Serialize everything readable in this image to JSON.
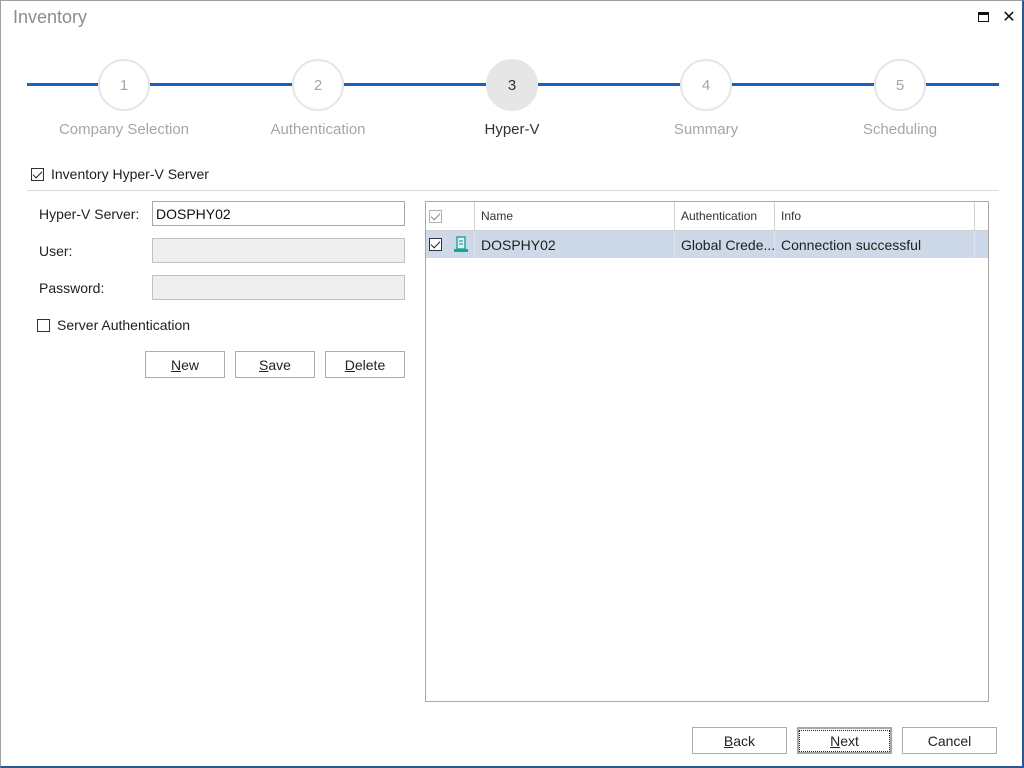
{
  "window": {
    "title": "Inventory",
    "maximize_icon": "maximize-icon",
    "close_icon": "close-icon",
    "close_glyph": "✕"
  },
  "stepper": {
    "accent_color": "#1565c0",
    "active_step": 3,
    "steps": [
      {
        "number": "1",
        "label": "Company Selection"
      },
      {
        "number": "2",
        "label": "Authentication"
      },
      {
        "number": "3",
        "label": "Hyper-V"
      },
      {
        "number": "4",
        "label": "Summary"
      },
      {
        "number": "5",
        "label": "Scheduling"
      }
    ]
  },
  "inventory_checkbox": {
    "label": "Inventory Hyper-V Server",
    "checked": true
  },
  "form": {
    "server_label": "Hyper-V Server:",
    "server_value": "DOSPHY02",
    "user_label": "User:",
    "user_value": "",
    "password_label": "Password:",
    "password_value": "",
    "server_auth_label": "Server Authentication",
    "server_auth_checked": false,
    "buttons": {
      "new_accel": "N",
      "new_rest": "ew",
      "save_accel": "S",
      "save_rest": "ave",
      "delete_accel": "D",
      "delete_rest": "elete"
    }
  },
  "grid": {
    "columns": [
      "",
      "Name",
      "Authentication",
      "Info"
    ],
    "select_all_checked": true,
    "rows": [
      {
        "checked": true,
        "icon": "server-icon",
        "name": "DOSPHY02",
        "authentication": "Global Crede...",
        "info": "Connection successful",
        "selected": true
      }
    ]
  },
  "footer": {
    "back_accel": "B",
    "back_rest": "ack",
    "next_accel": "N",
    "next_rest": "ext",
    "cancel_label": "Cancel"
  }
}
